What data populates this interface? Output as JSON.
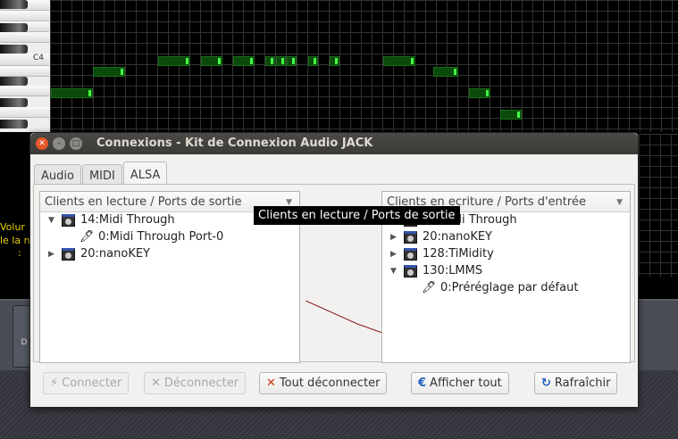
{
  "background": {
    "piano_label": "C4",
    "yellow_text": [
      "Volur",
      "le la n",
      ":"
    ],
    "side_button": "D"
  },
  "dialog": {
    "title": "Connexions - Kit de Connexion Audio JACK",
    "tabs": [
      {
        "label": "Audio"
      },
      {
        "label": "MIDI"
      },
      {
        "label": "ALSA"
      }
    ],
    "active_tab": "ALSA",
    "left_panel": {
      "header": "Clients en lecture / Ports de sortie",
      "items": [
        {
          "label": "14:Midi Through",
          "expanded": true
        },
        {
          "label": "0:Midi Through Port-0"
        },
        {
          "label": "20:nanoKEY",
          "expanded": false
        }
      ]
    },
    "right_panel": {
      "header": "Clients en ecriture / Ports d'entrée",
      "items": [
        {
          "label": "14:Midi Through"
        },
        {
          "label": "20:nanoKEY",
          "expanded": false
        },
        {
          "label": "128:TiMidity",
          "expanded": false
        },
        {
          "label": "130:LMMS",
          "expanded": true
        },
        {
          "label": "0:Préréglage par défaut"
        }
      ]
    },
    "tooltip": "Clients en lecture / Ports de sortie",
    "buttons": {
      "connect": "Connecter",
      "disconnect": "Déconnecter",
      "disconnect_all": "Tout déconnecter",
      "show_all": "Afficher tout",
      "refresh": "Rafraîchir"
    },
    "colors": {
      "wire": "#8b1a1a",
      "note": "#0a4a0a",
      "note_handle": "#44ff44"
    }
  }
}
